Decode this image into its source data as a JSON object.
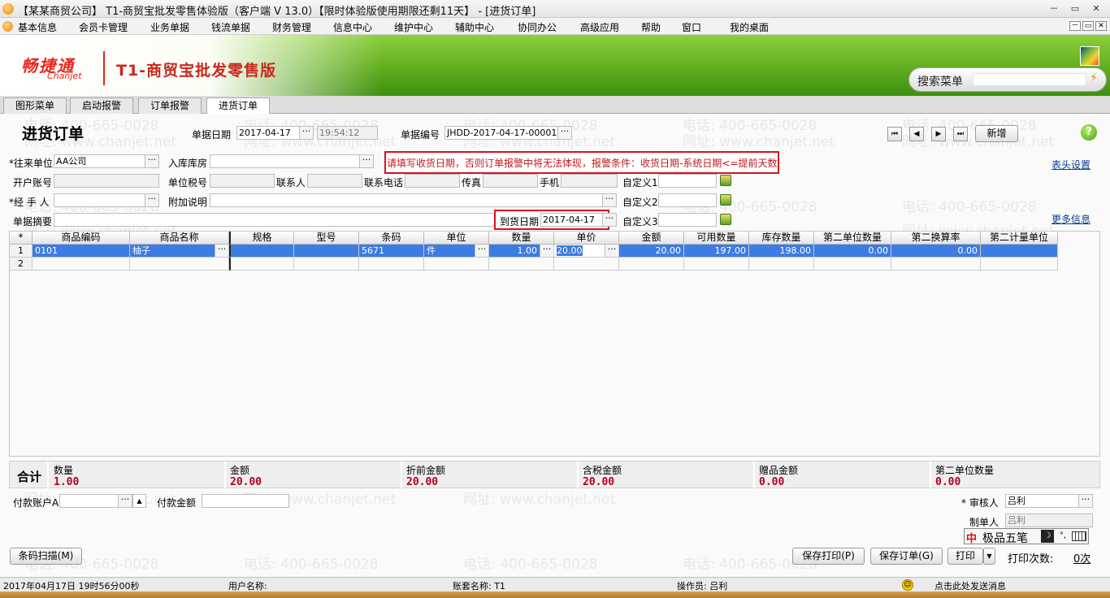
{
  "window": {
    "title": "【某某商贸公司】 T1-商贸宝批发零售体验版（客户端 V 13.0）【限时体验版使用期限还剩11天】 - [进货订单]",
    "min": "－",
    "restore": "▭",
    "close": "✕"
  },
  "menu": {
    "items": [
      "基本信息",
      "会员卡管理",
      "业务单据",
      "钱流单据",
      "财务管理",
      "信息中心",
      "维护中心",
      "辅助中心",
      "协同办公",
      "高级应用",
      "帮助",
      "窗口",
      "我的桌面"
    ]
  },
  "banner": {
    "logo_cn": "畅捷通",
    "logo_en": "Chanjet",
    "product": "T1-商贸宝批发零售版",
    "search_label": "搜索菜单",
    "search_value": ""
  },
  "tabs": [
    "图形菜单",
    "启动报警",
    "订单报警",
    "进货订单"
  ],
  "watermark": {
    "phone": "电话: 400-665-0028",
    "site": "网址: www.chanjet.net"
  },
  "form": {
    "title": "进货订单",
    "doc_date_label": "单据日期",
    "doc_date": "2017-04-17",
    "doc_time": "19:54:12",
    "doc_no_label": "单据编号",
    "doc_no": "JHDD-2017-04-17-00001",
    "nav": {
      "first": "⏮",
      "prev": "◀",
      "next": "▶",
      "last": "⏭"
    },
    "new_label": "新增",
    "help_icon": "?",
    "vendor_label": "*往来单位",
    "vendor": "AA公司",
    "warehouse_label": "入库库房",
    "warehouse": "",
    "notice": "请填写收货日期，否则订单报警中将无法体现，报警条件：收货日期-系统日期<=提前天数",
    "header_settings": "表头设置",
    "account_label": "开户账号",
    "tax_label": "单位税号",
    "contact_label": "联系人",
    "phone_label": "联系电话",
    "fax_label": "传真",
    "mobile_label": "手机",
    "custom1_label": "自定义1",
    "custom2_label": "自定义2",
    "custom3_label": "自定义3",
    "handler_label": "*经 手 人",
    "handler": "",
    "extra_label": "附加说明",
    "extra": "",
    "summary_label": "单据摘要",
    "summary": "",
    "arrival_label": "到货日期",
    "arrival": "2017-04-17",
    "more_info": "更多信息"
  },
  "grid": {
    "headers": [
      "*",
      "商品编码",
      "商品名称",
      "规格",
      "型号",
      "条码",
      "单位",
      "数量",
      "单价",
      "金额",
      "可用数量",
      "库存数量",
      "第二单位数量",
      "第二换算率",
      "第二计量单位"
    ],
    "rows": [
      {
        "n": "1",
        "code": "0101",
        "name": "柚子",
        "spec": "",
        "model": "",
        "barcode": "5671",
        "unit": "件",
        "qty": "1.00",
        "price": "20.00",
        "amount": "20.00",
        "avail": "197.00",
        "stock": "198.00",
        "qty2": "0.00",
        "rate2": "0.00",
        "unit2": ""
      },
      {
        "n": "2",
        "code": "",
        "name": "",
        "spec": "",
        "model": "",
        "barcode": "",
        "unit": "",
        "qty": "",
        "price": "",
        "amount": "",
        "avail": "",
        "stock": "",
        "qty2": "",
        "rate2": "",
        "unit2": ""
      }
    ]
  },
  "totals": {
    "label": "合计",
    "qty_label": "数量",
    "qty": "1.00",
    "amount_label": "金额",
    "amount": "20.00",
    "pre_discount_label": "折前金额",
    "pre_discount": "20.00",
    "tax_amount_label": "含税金额",
    "tax_amount": "20.00",
    "gift_label": "赠品金额",
    "gift": "0.00",
    "qty2_label": "第二单位数量",
    "qty2": "0.00"
  },
  "payment": {
    "account_label": "付款账户A",
    "account": "",
    "amount_label": "付款金额",
    "amount": ""
  },
  "approval": {
    "reviewer_label": "* 审核人",
    "reviewer": "吕利",
    "maker_label": "制单人",
    "maker": "吕利"
  },
  "ime": {
    "name": "极品五笔",
    "mark": "中"
  },
  "buttons": {
    "barcode_scan": "条码扫描(M)",
    "save_print": "保存打印(P)",
    "save_order": "保存订单(G)",
    "print": "打印",
    "print_count_label": "打印次数:",
    "print_count": "0次"
  },
  "status": {
    "datetime": "2017年04月17日    19时56分00秒",
    "user": "用户名称:",
    "account_set": "账套名称: T1",
    "operator": "操作员: 吕利",
    "message": "点击此处发送消息"
  }
}
